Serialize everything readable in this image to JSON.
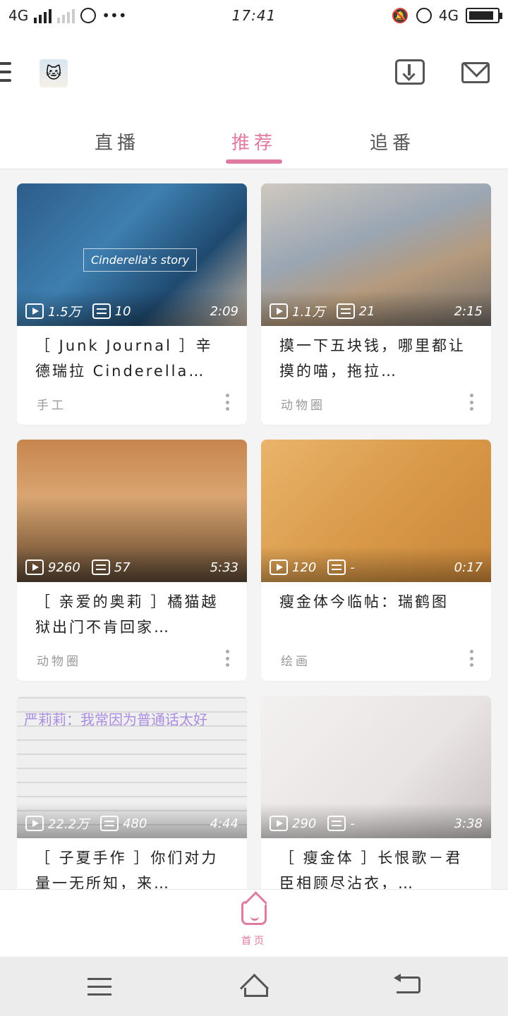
{
  "status_bar": {
    "network": "4G",
    "time": "17:41",
    "network_right": "4G",
    "battery_level": 0.9
  },
  "header": {
    "tabs": [
      {
        "label": "直播",
        "active": false
      },
      {
        "label": "推荐",
        "active": true
      },
      {
        "label": "追番",
        "active": false
      }
    ],
    "accent_color": "#e07aa0"
  },
  "feed": [
    {
      "views": "1.5万",
      "danmaku": "10",
      "duration": "2:09",
      "title": "［ Junk Journal ］辛德瑞拉 Cinderella…",
      "tag": "手工",
      "overlay": "Cinderella's story"
    },
    {
      "views": "1.1万",
      "danmaku": "21",
      "duration": "2:15",
      "title": "摸一下五块钱，哪里都让摸的喵，拖拉…",
      "tag": "动物圈",
      "overlay": ""
    },
    {
      "views": "9260",
      "danmaku": "57",
      "duration": "5:33",
      "title": "［ 亲爱的奥莉 ］橘猫越狱出门不肯回家…",
      "tag": "动物圈",
      "overlay": ""
    },
    {
      "views": "120",
      "danmaku": "-",
      "duration": "0:17",
      "title": "瘦金体今临帖：瑞鹤图",
      "tag": "绘画",
      "overlay": ""
    },
    {
      "views": "22.2万",
      "danmaku": "480",
      "duration": "4:44",
      "title": "［ 子夏手作 ］你们对力量一无所知，来…",
      "tag": "",
      "overlay": "严莉莉：我常因为普通话太好"
    },
    {
      "views": "290",
      "danmaku": "-",
      "duration": "3:38",
      "title": "［ 瘦金体 ］长恨歌－君臣相顾尽沾衣，…",
      "tag": "",
      "overlay": ""
    }
  ],
  "bottom_nav": {
    "home_label": "首页"
  }
}
